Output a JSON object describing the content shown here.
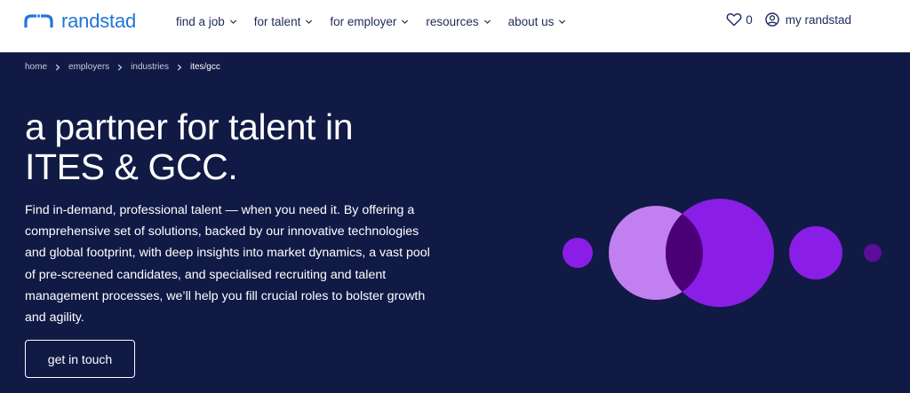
{
  "header": {
    "logo_text": "randstad",
    "nav": [
      {
        "label": "find a job"
      },
      {
        "label": "for talent"
      },
      {
        "label": "for employer"
      },
      {
        "label": "resources"
      },
      {
        "label": "about us"
      }
    ],
    "favorites_count": "0",
    "account_label": "my randstad"
  },
  "breadcrumb": [
    "home",
    "employers",
    "industries",
    "ites/gcc"
  ],
  "hero": {
    "title_line1": "a partner for talent in",
    "title_line2": "ITES & GCC.",
    "intro": "Find in-demand, professional talent — when you need it. By offering a comprehensive set of solutions, backed by our innovative technologies and global footprint, with deep insights into market dynamics, a vast pool of pre-screened candidates, and specialised recruiting and talent management processes, we’ll help you fill crucial roles to bolster growth and agility.",
    "cta_label": "get in touch"
  },
  "colors": {
    "brand_blue": "#2175d9",
    "navy_background": "#101a45",
    "violet": "#8a1ee6",
    "lavender": "#c27fef",
    "overlap_purple": "#4b0078",
    "dark_violet": "#5c0e9a"
  },
  "icons": [
    "randstad-logo-icon",
    "chevron-down-icon",
    "heart-icon",
    "user-circle-icon",
    "chevron-right-icon"
  ]
}
